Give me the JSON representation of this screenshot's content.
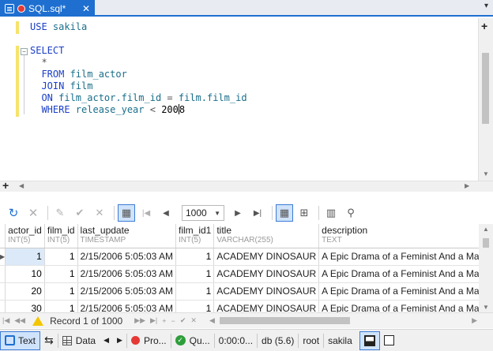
{
  "tab": {
    "title": "SQL.sql*",
    "close": "✕",
    "menu": "▾"
  },
  "editor": {
    "lines": [
      [
        {
          "t": "USE ",
          "c": "kw"
        },
        {
          "t": "sakila",
          "c": "id"
        }
      ],
      [],
      [
        {
          "t": "SELECT",
          "c": "kw"
        }
      ],
      [
        {
          "t": "  *",
          "c": "op"
        }
      ],
      [
        {
          "t": "  FROM ",
          "c": "kw"
        },
        {
          "t": "film_actor",
          "c": "id"
        }
      ],
      [
        {
          "t": "  JOIN ",
          "c": "kw"
        },
        {
          "t": "film",
          "c": "id"
        }
      ],
      [
        {
          "t": "  ON ",
          "c": "kw"
        },
        {
          "t": "film_actor.film_id",
          "c": "id"
        },
        {
          "t": " = ",
          "c": "op"
        },
        {
          "t": "film.film_id",
          "c": "id"
        }
      ],
      [
        {
          "t": "  WHERE ",
          "c": "kw"
        },
        {
          "t": "release_year",
          "c": "id"
        },
        {
          "t": " < ",
          "c": "op"
        },
        {
          "t": "200",
          "c": "num"
        },
        {
          "t": "|",
          "c": "caret"
        },
        {
          "t": "8",
          "c": "num"
        }
      ]
    ]
  },
  "results_toolbar": {
    "limit_value": "1000"
  },
  "grid": {
    "columns": [
      {
        "name": "actor_id",
        "type": "INT(5)"
      },
      {
        "name": "film_id",
        "type": "INT(5)"
      },
      {
        "name": "last_update",
        "type": "TIMESTAMP"
      },
      {
        "name": "film_id1",
        "type": "INT(5)"
      },
      {
        "name": "title",
        "type": "VARCHAR(255)"
      },
      {
        "name": "description",
        "type": "TEXT"
      }
    ],
    "rows": [
      [
        "1",
        "1",
        "2/15/2006 5:05:03 AM",
        "1",
        "ACADEMY DINOSAUR",
        "A Epic Drama of a Feminist And a Mad Sc"
      ],
      [
        "10",
        "1",
        "2/15/2006 5:05:03 AM",
        "1",
        "ACADEMY DINOSAUR",
        "A Epic Drama of a Feminist And a Mad Sc"
      ],
      [
        "20",
        "1",
        "2/15/2006 5:05:03 AM",
        "1",
        "ACADEMY DINOSAUR",
        "A Epic Drama of a Feminist And a Mad Sc"
      ],
      [
        "30",
        "1",
        "2/15/2006 5:05:03 AM",
        "1",
        "ACADEMY DINOSAUR",
        "A Epic Drama of a Feminist And a Mad Sc"
      ]
    ],
    "selected_row": 0
  },
  "navbar": {
    "record_text": "Record 1 of 1000"
  },
  "status": {
    "text_label": "Text",
    "data_label": "Data",
    "pro_label": "Pro...",
    "qu_label": "Qu...",
    "time": "0:00:0...",
    "db": "db (5.6)",
    "user": "root",
    "schema": "sakila"
  },
  "colors": {
    "accent": "#1e6fd0",
    "keyword": "#1a3ec7",
    "identifier": "#1a6e8a",
    "selection": "#dce9f8"
  }
}
